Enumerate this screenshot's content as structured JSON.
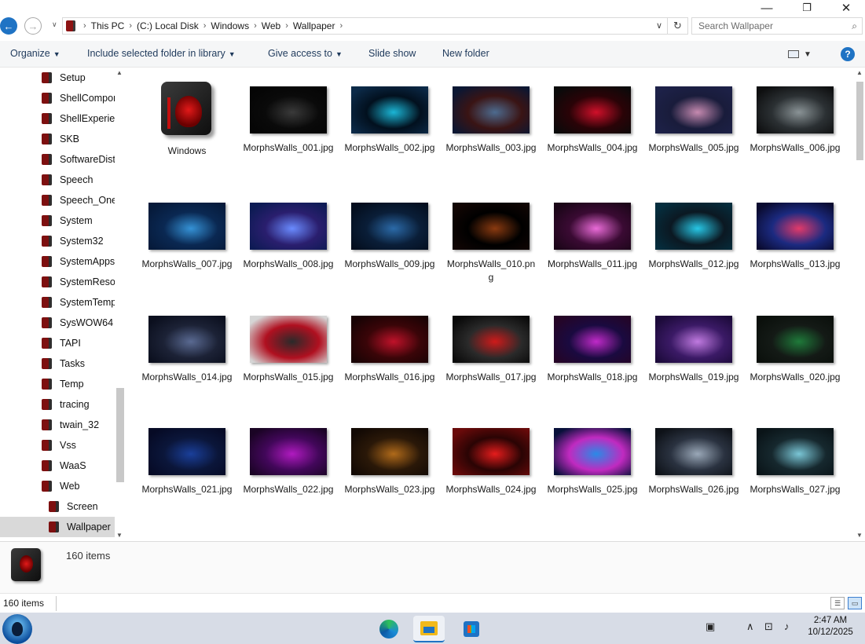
{
  "window": {
    "controls": {
      "minimize": "—",
      "restore": "❐",
      "close": "✕"
    }
  },
  "address": {
    "breadcrumbs": [
      "This PC",
      "(C:) Local Disk",
      "Windows",
      "Web",
      "Wallpaper"
    ],
    "search_placeholder": "Search Wallpaper"
  },
  "commands": {
    "organize": "Organize",
    "include": "Include selected folder in library",
    "give_access": "Give access to",
    "slideshow": "Slide show",
    "new_folder": "New folder",
    "help": "?"
  },
  "nav": {
    "items": [
      "Setup",
      "ShellComponents",
      "ShellExperiences",
      "SKB",
      "SoftwareDistribution",
      "Speech",
      "Speech_OneCore",
      "System",
      "System32",
      "SystemApps",
      "SystemResources",
      "SystemTemp",
      "SysWOW64",
      "TAPI",
      "Tasks",
      "Temp",
      "tracing",
      "twain_32",
      "Vss",
      "WaaS",
      "Web",
      "Screen",
      "Wallpaper"
    ],
    "selected": "Wallpaper"
  },
  "content": {
    "items": [
      {
        "name": "Windows",
        "type": "folder"
      },
      {
        "name": "MorphsWalls_001.jpg",
        "colors": [
          "#050505",
          "#3a3a3a",
          "#0a0a0a"
        ]
      },
      {
        "name": "MorphsWalls_002.jpg",
        "colors": [
          "#0c2a48",
          "#1bb6d6",
          "#02101e"
        ]
      },
      {
        "name": "MorphsWalls_003.jpg",
        "colors": [
          "#0b1733",
          "#4d6b8f",
          "#3a1414"
        ]
      },
      {
        "name": "MorphsWalls_004.jpg",
        "colors": [
          "#0a0a0a",
          "#d0102a",
          "#2a0307"
        ]
      },
      {
        "name": "MorphsWalls_005.jpg",
        "colors": [
          "#1d2148",
          "#c68ab0",
          "#191c3b"
        ]
      },
      {
        "name": "MorphsWalls_006.jpg",
        "colors": [
          "#0e0f10",
          "#8a9396",
          "#2b3033"
        ]
      },
      {
        "name": "MorphsWalls_007.jpg",
        "colors": [
          "#061a3a",
          "#3592d6",
          "#0a2852"
        ]
      },
      {
        "name": "MorphsWalls_008.jpg",
        "colors": [
          "#0d1b54",
          "#6a8bff",
          "#2a1e6e"
        ]
      },
      {
        "name": "MorphsWalls_009.jpg",
        "colors": [
          "#040e1e",
          "#2b6aa8",
          "#0a1e38"
        ]
      },
      {
        "name": "MorphsWalls_010.png",
        "colors": [
          "#120604",
          "#8a3a10",
          "#000000"
        ]
      },
      {
        "name": "MorphsWalls_011.jpg",
        "colors": [
          "#1b0618",
          "#ea6bd8",
          "#3a0a33"
        ]
      },
      {
        "name": "MorphsWalls_012.jpg",
        "colors": [
          "#052e3e",
          "#27c7e6",
          "#0b1822"
        ]
      },
      {
        "name": "MorphsWalls_013.jpg",
        "colors": [
          "#0a0b30",
          "#e23a6a",
          "#1b2a80"
        ]
      },
      {
        "name": "MorphsWalls_014.jpg",
        "colors": [
          "#0b0f1e",
          "#5a6a92",
          "#1c2236"
        ]
      },
      {
        "name": "MorphsWalls_015.jpg",
        "colors": [
          "#d5d5d5",
          "#2a2a2a",
          "#b01020"
        ]
      },
      {
        "name": "MorphsWalls_016.jpg",
        "colors": [
          "#180304",
          "#c0122a",
          "#3a0508"
        ]
      },
      {
        "name": "MorphsWalls_017.jpg",
        "colors": [
          "#0a0a0a",
          "#cf1a1a",
          "#2a2a2a"
        ]
      },
      {
        "name": "MorphsWalls_018.jpg",
        "colors": [
          "#250526",
          "#c02ac9",
          "#1a0a40"
        ]
      },
      {
        "name": "MorphsWalls_019.jpg",
        "colors": [
          "#1c0a3a",
          "#c07ae0",
          "#3b1a66"
        ]
      },
      {
        "name": "MorphsWalls_020.jpg",
        "colors": [
          "#0b100c",
          "#1f7a3a",
          "#141a16"
        ]
      },
      {
        "name": "MorphsWalls_021.jpg",
        "colors": [
          "#060a25",
          "#1a3f9a",
          "#0b163a"
        ]
      },
      {
        "name": "MorphsWalls_022.jpg",
        "colors": [
          "#1a0424",
          "#b01ac0",
          "#42075a"
        ]
      },
      {
        "name": "MorphsWalls_023.jpg",
        "colors": [
          "#120904",
          "#b06a1a",
          "#2a1808"
        ]
      },
      {
        "name": "MorphsWalls_024.jpg",
        "colors": [
          "#6a0a0a",
          "#e51c1c",
          "#2a0404"
        ]
      },
      {
        "name": "MorphsWalls_025.jpg",
        "colors": [
          "#08103a",
          "#2a8ae6",
          "#c02ac0"
        ]
      },
      {
        "name": "MorphsWalls_026.jpg",
        "colors": [
          "#0e1218",
          "#9aa8b8",
          "#2a3240"
        ]
      },
      {
        "name": "MorphsWalls_027.jpg",
        "colors": [
          "#0a1418",
          "#7ac6d6",
          "#16282e"
        ]
      }
    ]
  },
  "details": {
    "count": "160 items"
  },
  "status": {
    "count": "160 items"
  },
  "taskbar": {
    "time": "2:47 AM",
    "date": "10/12/2025"
  },
  "colors": {
    "accent": "#1f73c4",
    "brand_red": "#c30f0f"
  }
}
